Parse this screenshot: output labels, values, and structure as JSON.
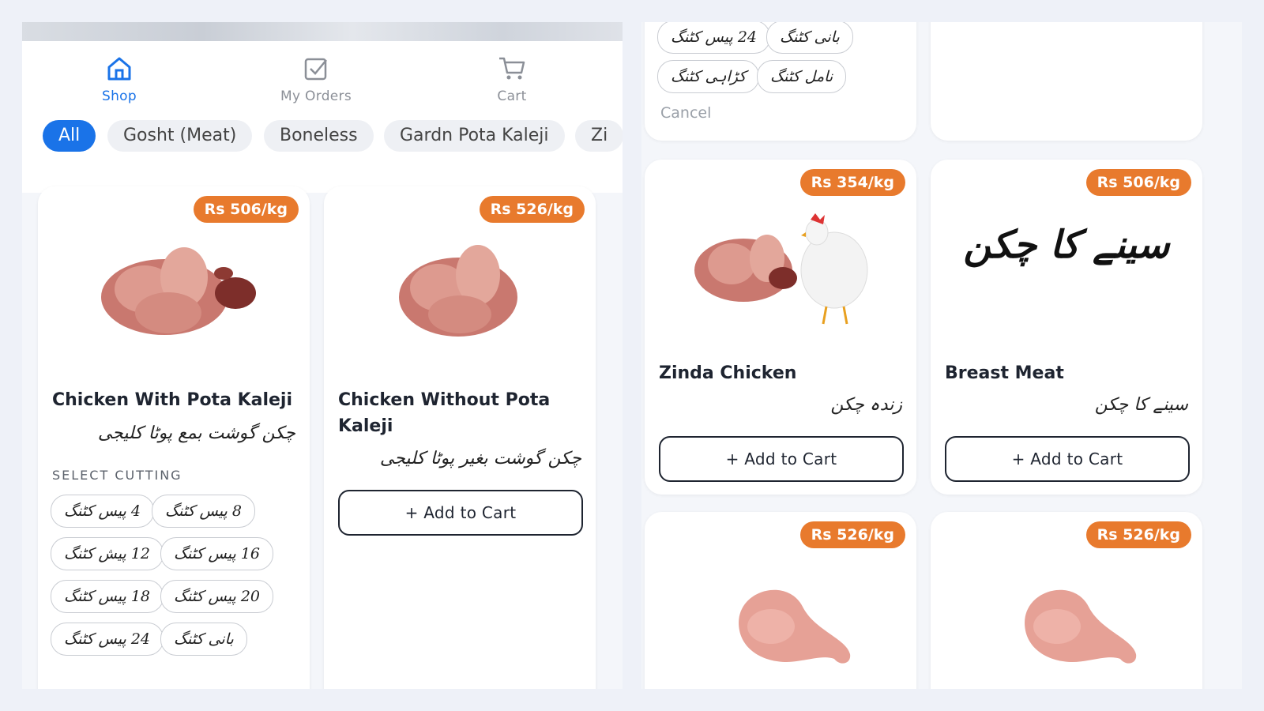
{
  "nav": {
    "shop": "Shop",
    "orders": "My Orders",
    "cart": "Cart"
  },
  "categories": [
    "All",
    "Gosht (Meat)",
    "Boneless",
    "Gardn Pota Kaleji",
    "Zi"
  ],
  "left_products": [
    {
      "price": "Rs 506/kg",
      "title": "Chicken With Pota Kaleji",
      "urdu": "چکن گوشت بمع پوٹا کلیجی",
      "select_label": "SELECT CUTTING",
      "cuttings": [
        "4 پیس کٹنگ",
        "8 پیس کٹنگ",
        "12 پیش کٹنگ",
        "16 پیس کٹنگ",
        "18 پیس کٹنگ",
        "20 پیس کٹنگ",
        "24 پیس کٹنگ",
        "بانی کٹنگ"
      ]
    },
    {
      "price": "Rs 526/kg",
      "title": "Chicken Without Pota Kaleji",
      "urdu": "چکن گوشت بغیر پوٹا کلیجی",
      "button": "+ Add to Cart"
    }
  ],
  "right_top": {
    "cuttings": [
      "24 پیس کٹنگ",
      "بانی کٹنگ",
      "کڑاہی کٹنگ",
      "نامل کٹنگ"
    ],
    "cancel": "Cancel"
  },
  "right_products": [
    {
      "price": "Rs 354/kg",
      "title": "Zinda Chicken",
      "urdu": "زندہ چکن",
      "button": "+ Add to Cart"
    },
    {
      "price": "Rs 506/kg",
      "title": "Breast Meat",
      "urdu": "سینے کا چکن",
      "image_text": "سینے کا چکن",
      "button": "+ Add to Cart"
    },
    {
      "price": "Rs 526/kg"
    },
    {
      "price": "Rs 526/kg"
    }
  ],
  "colors": {
    "accent": "#1a73e8",
    "price_badge": "#e87a2d",
    "text": "#1e2430"
  }
}
